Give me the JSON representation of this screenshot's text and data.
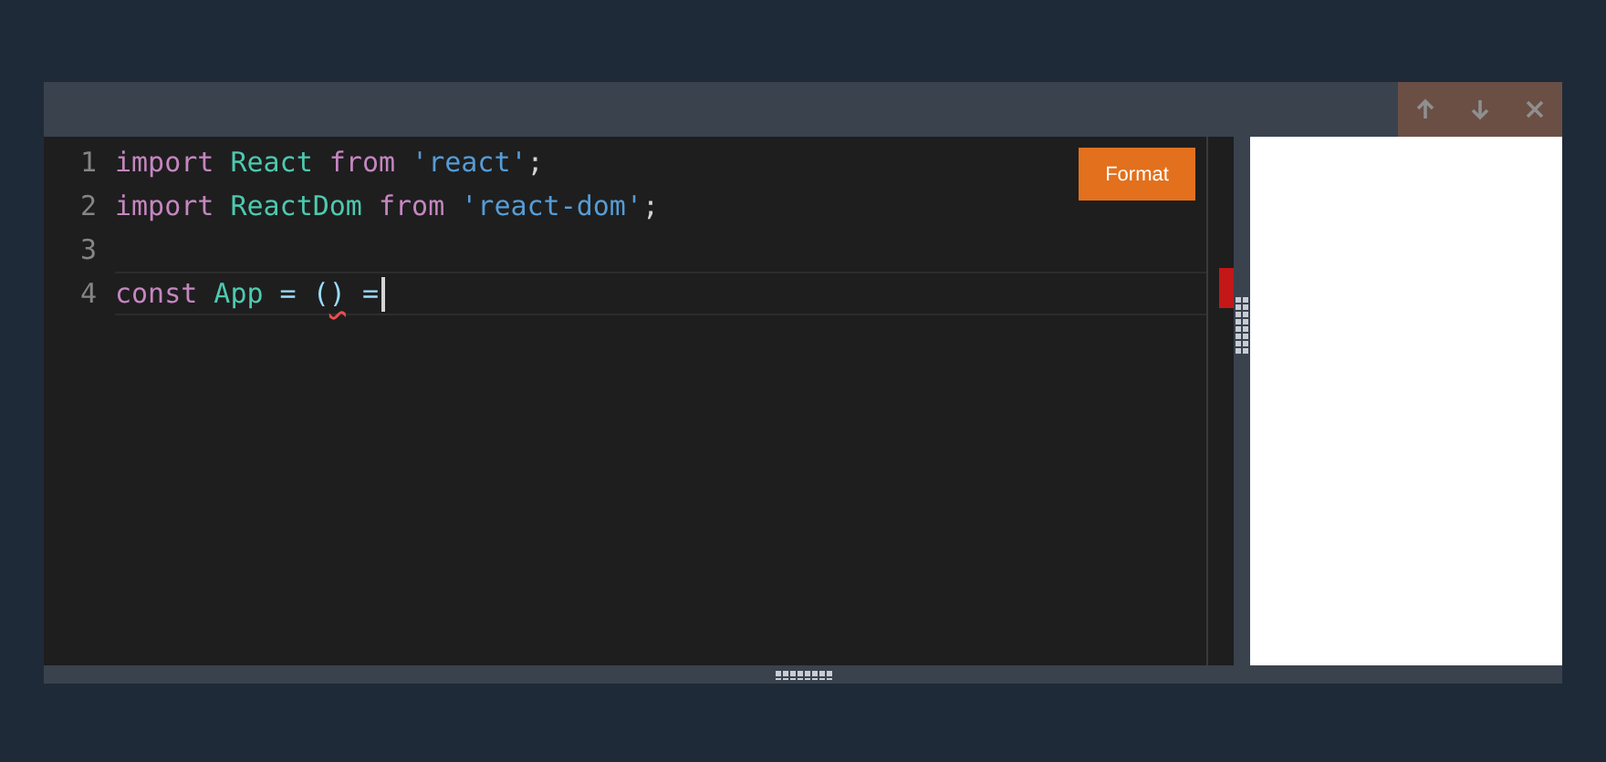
{
  "toolbar": {
    "buttons": [
      {
        "kind": "up"
      },
      {
        "kind": "down"
      },
      {
        "kind": "close"
      }
    ]
  },
  "editor": {
    "format_button": "Format",
    "lines": [
      {
        "number": "1",
        "active": false,
        "tokens": [
          {
            "text": "import",
            "kind": "keyword"
          },
          {
            "text": " React",
            "kind": "name"
          },
          {
            "text": " from",
            "kind": "keyword"
          },
          {
            "text": " 'react'",
            "kind": "string"
          },
          {
            "text": ";",
            "kind": "plain"
          }
        ]
      },
      {
        "number": "2",
        "active": false,
        "tokens": [
          {
            "text": "import",
            "kind": "keyword"
          },
          {
            "text": " ReactDom",
            "kind": "name"
          },
          {
            "text": " from",
            "kind": "keyword"
          },
          {
            "text": " 'react-dom'",
            "kind": "string"
          },
          {
            "text": ";",
            "kind": "plain"
          }
        ]
      },
      {
        "number": "3",
        "active": false
      },
      {
        "number": "4",
        "active": true,
        "tokens": [
          {
            "text": "const",
            "kind": "keyword"
          },
          {
            "text": " App",
            "kind": "name"
          },
          {
            "text": " = (",
            "kind": "operator"
          },
          {
            "text": ")",
            "kind": "invalid"
          },
          {
            "text": " =",
            "kind": "operator"
          }
        ],
        "cursor": true
      }
    ],
    "error_marker": true
  }
}
